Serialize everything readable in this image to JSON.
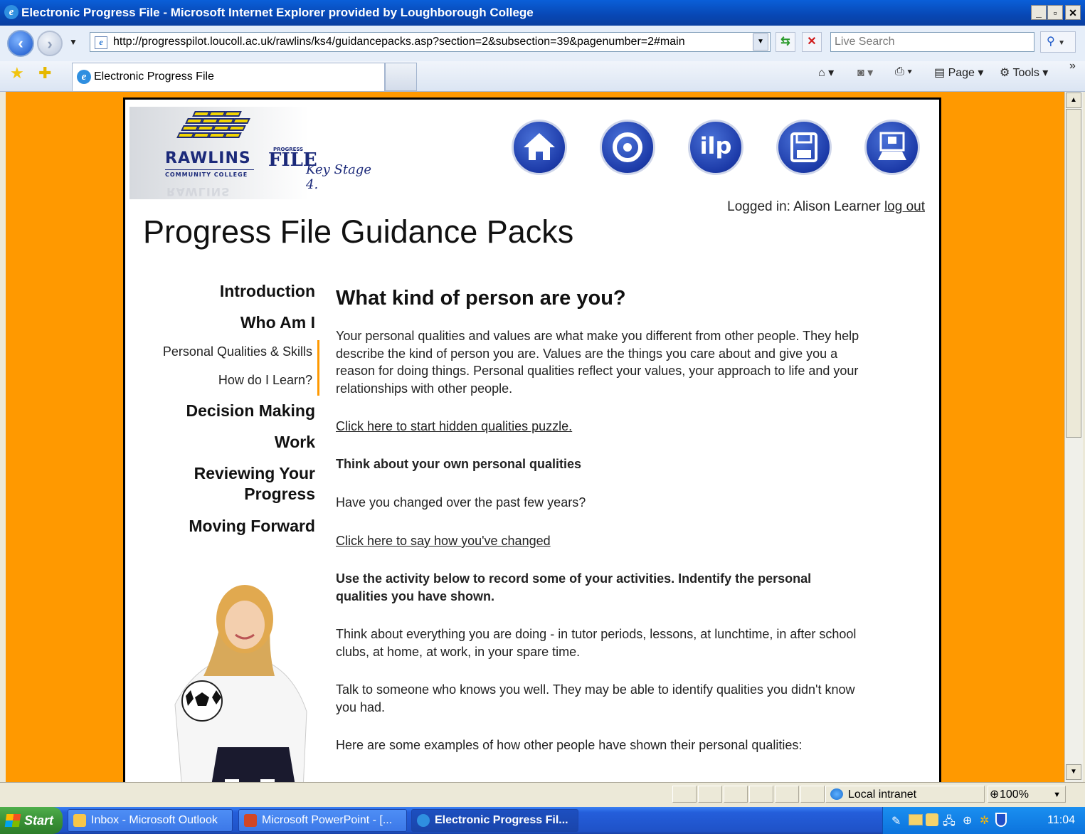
{
  "window": {
    "title": "Electronic Progress File - Microsoft Internet Explorer provided by Loughborough College"
  },
  "toolbar": {
    "url": "http://progresspilot.loucoll.ac.uk/rawlins/ks4/guidancepacks.asp?section=2&subsection=39&pagenumber=2#main",
    "search_placeholder": "Live Search",
    "tab_label": "Electronic Progress File",
    "page_label": "Page",
    "tools_label": "Tools"
  },
  "site": {
    "logo": {
      "name": "RAWLINS",
      "subtitle": "COMMUNITY COLLEGE",
      "progress_small": "PROGRESS",
      "file": "FILE",
      "key_stage": "Key Stage 4."
    },
    "nav_icons": [
      "home-icon",
      "target-icon",
      "ilp-icon",
      "save-icon",
      "presentation-icon"
    ],
    "ilp_label": "ilp",
    "logged_in_text": "Logged in: Alison Learner",
    "logout_label": "log out",
    "page_title": "Progress File Guidance Packs"
  },
  "sidebar": {
    "items": [
      {
        "label": "Introduction"
      },
      {
        "label": "Who Am I"
      },
      {
        "label": "Personal Qualities & Skills"
      },
      {
        "label": "How do I Learn?"
      },
      {
        "label": "Decision Making"
      },
      {
        "label": "Work"
      },
      {
        "label": "Reviewing Your"
      },
      {
        "label": "Progress"
      },
      {
        "label": "Moving Forward"
      }
    ]
  },
  "main": {
    "heading": "What kind of person are you?",
    "intro_line1": "Your personal qualities and values are what make you different from other people. They help",
    "intro_line2": "describe the kind of person you are. Values are the things you care about and give you a",
    "intro_line3": "reason for doing things. Personal qualities reflect your values, your approach to life and your",
    "intro_line4": "relationships with other people.",
    "puzzle_link": "Click here to start hidden qualities puzzle.",
    "think_heading": "Think about your own personal qualities",
    "changed_question": "Have you changed over the past few years?",
    "changed_link": "Click here to say how you've changed",
    "activity_line1": "Use the activity below to record some of your activities. Indentify the personal",
    "activity_line2": "qualities you have shown.",
    "think_line1": "Think about everything you are doing - in tutor periods, lessons, at lunchtime, in after school",
    "think_line2": "clubs, at home, at work, in your spare time.",
    "talk_line1": "Talk to someone who knows you well. They may be able to identify qualities you didn't know",
    "talk_line2": "you had.",
    "examples_line": "Here are some examples of how other people have shown their personal qualities:"
  },
  "statusbar": {
    "zone": "Local intranet",
    "zoom": "100%"
  },
  "taskbar": {
    "start_label": "Start",
    "tasks": [
      {
        "label": "Inbox - Microsoft Outlook"
      },
      {
        "label": "Microsoft PowerPoint - [..."
      },
      {
        "label": "Electronic Progress Fil..."
      }
    ],
    "clock": "11:04"
  }
}
